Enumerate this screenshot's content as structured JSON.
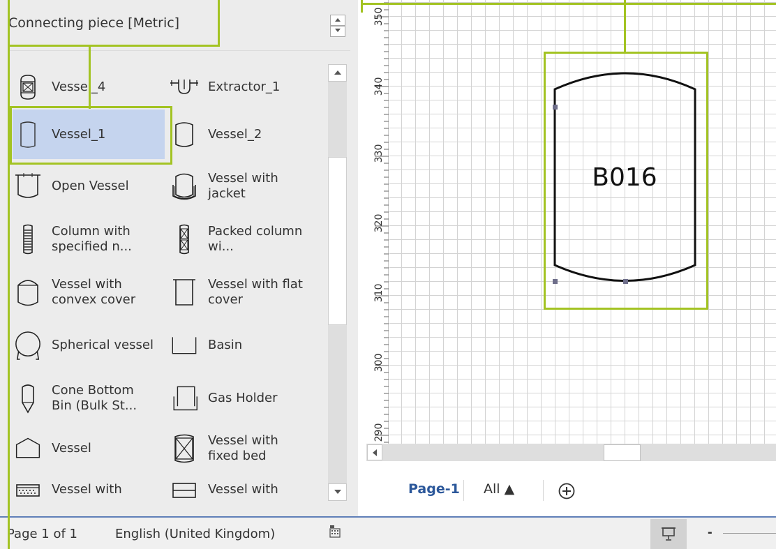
{
  "stencil": {
    "title": "Connecting piece [Metric]"
  },
  "shapes": [
    {
      "label": "Vessel_4",
      "icon": "vessel-4-icon"
    },
    {
      "label": "Extractor_1",
      "icon": "extractor-icon"
    },
    {
      "label": "Vessel_1",
      "icon": "vessel-1-icon"
    },
    {
      "label": "Vessel_2",
      "icon": "vessel-2-icon"
    },
    {
      "label": "Open Vessel",
      "icon": "open-vessel-icon"
    },
    {
      "label": "Vessel with jacket",
      "icon": "vessel-jacket-icon"
    },
    {
      "label": "Column with specified n...",
      "icon": "column-icon"
    },
    {
      "label": "Packed column wi...",
      "icon": "packed-column-icon"
    },
    {
      "label": "Vessel with convex cover",
      "icon": "vessel-convex-icon"
    },
    {
      "label": "Vessel with flat cover",
      "icon": "vessel-flat-icon"
    },
    {
      "label": "Spherical vessel",
      "icon": "spherical-vessel-icon"
    },
    {
      "label": "Basin",
      "icon": "basin-icon"
    },
    {
      "label": "Cone Bottom Bin (Bulk St...",
      "icon": "cone-bin-icon"
    },
    {
      "label": "Gas Holder",
      "icon": "gas-holder-icon"
    },
    {
      "label": "Vessel",
      "icon": "vessel-icon"
    },
    {
      "label": "Vessel with fixed bed",
      "icon": "fixed-bed-icon"
    },
    {
      "label": "Vessel with",
      "icon": "vessel-dotted-icon"
    },
    {
      "label": "Vessel with",
      "icon": "vessel-lines-icon"
    }
  ],
  "ruler": {
    "ticks": [
      "350",
      "340",
      "330",
      "320",
      "310",
      "300",
      "290"
    ]
  },
  "canvas": {
    "shape_label": "B016"
  },
  "tabs": {
    "page": "Page-1",
    "all": "All ▲",
    "add_icon": "plus-circle-icon"
  },
  "status": {
    "page": "Page 1 of 1",
    "language": "English (United Kingdom)",
    "zoom_minus": "-"
  },
  "colors": {
    "highlight": "#a3c323",
    "selection": "#c5d4ee",
    "active_tab": "#2b579a"
  }
}
